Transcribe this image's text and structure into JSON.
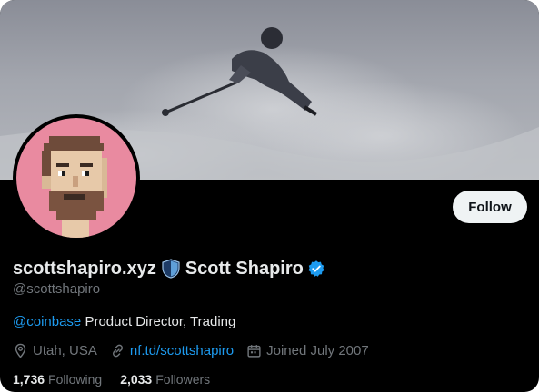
{
  "profile": {
    "name_primary": "scottshapiro.xyz",
    "name_secondary": "Scott Shapiro",
    "handle": "@scottshapiro",
    "follow_label": "Follow",
    "bio": {
      "mention": "@coinbase",
      "text": " Product Director, Trading"
    },
    "meta": {
      "location": "Utah, USA",
      "link": "nf.td/scottshapiro",
      "joined": "Joined July 2007"
    },
    "stats": {
      "following_count": "1,736",
      "following_label": "Following",
      "followers_count": "2,033",
      "followers_label": "Followers"
    }
  },
  "icons": {
    "badge": "shield-icon",
    "verified": "verified-badge-icon",
    "location": "location-pin-icon",
    "link": "link-icon",
    "calendar": "calendar-icon"
  },
  "colors": {
    "background": "#000000",
    "text_primary": "#e7e9ea",
    "text_secondary": "#71767b",
    "accent": "#1d9bf0",
    "follow_button_bg": "#eff3f4",
    "avatar_bg": "#e98aa0"
  }
}
